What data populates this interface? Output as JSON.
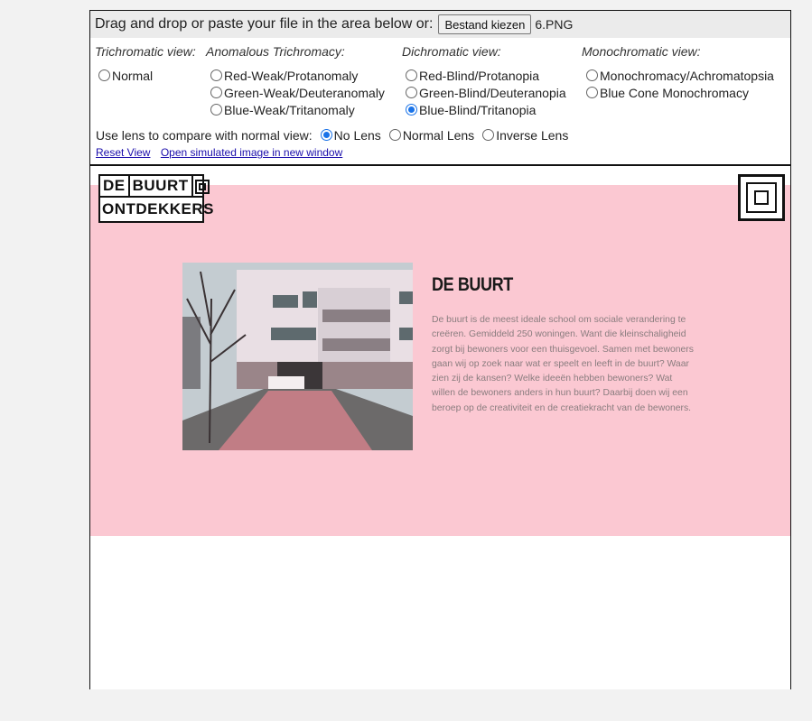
{
  "topbar": {
    "prompt": "Drag and drop or paste your file in the area below or:",
    "file_button": "Bestand kiezen",
    "file_name": "6.PNG"
  },
  "columns": {
    "trichromatic": {
      "title": "Trichromatic view:",
      "options": [
        "Normal"
      ]
    },
    "anomalous": {
      "title": "Anomalous Trichromacy:",
      "options": [
        "Red-Weak/Protanomaly",
        "Green-Weak/Deuteranomaly",
        "Blue-Weak/Tritanomaly"
      ]
    },
    "dichromatic": {
      "title": "Dichromatic view:",
      "options": [
        "Red-Blind/Protanopia",
        "Green-Blind/Deuteranopia",
        "Blue-Blind/Tritanopia"
      ]
    },
    "monochromatic": {
      "title": "Monochromatic view:",
      "options": [
        "Monochromacy/Achromatopsia",
        "Blue Cone Monochromacy"
      ]
    }
  },
  "selected_view": "Blue-Blind/Tritanopia",
  "lens": {
    "label": "Use lens to compare with normal view:",
    "options": [
      "No Lens",
      "Normal Lens",
      "Inverse Lens"
    ],
    "selected": "No Lens"
  },
  "links": {
    "reset": "Reset View",
    "open": "Open simulated image in new window"
  },
  "site": {
    "logo_line1": [
      "DE",
      "BUURT"
    ],
    "logo_line2": "ONTDEKKERS",
    "heading": "DE BUURT",
    "body": "De buurt is de meest ideale school om sociale verandering te creëren. Gemiddeld 250 woningen. Want die kleinschaligheid zorgt bij bewoners voor een thuisgevoel. Samen met bewoners gaan wij op zoek naar wat er speelt en leeft in de buurt? Waar zien zij de kansen? Welke ideeën hebben bewoners? Wat willen de bewoners anders in hun buurt? Daarbij doen wij een beroep op de creativiteit en de creatiekracht van de bewoners."
  },
  "colors": {
    "pink_background": "#fbc8d2",
    "link": "#1a0dab",
    "radio_accent": "#1a73e8"
  }
}
